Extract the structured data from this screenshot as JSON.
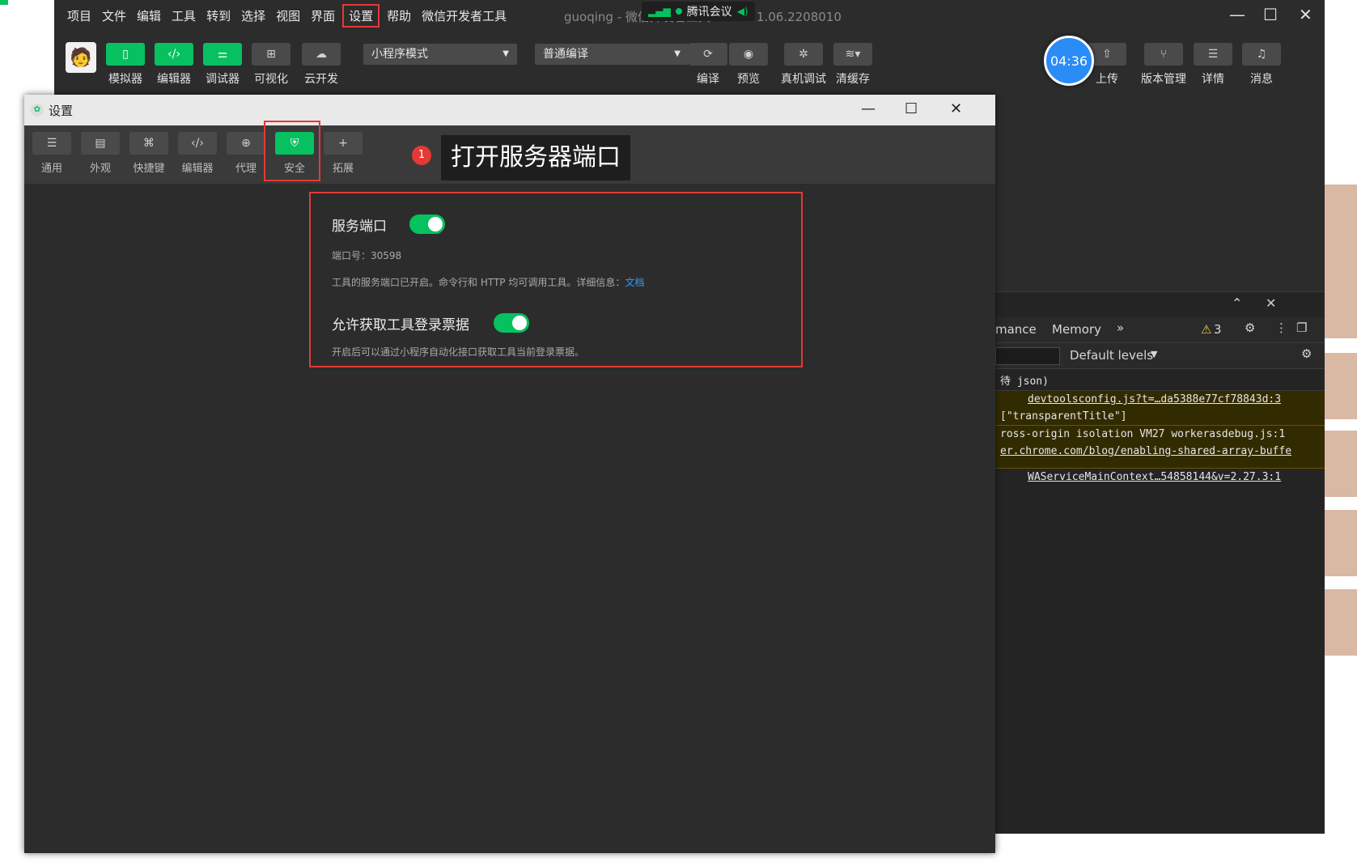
{
  "menu": {
    "items": [
      "项目",
      "文件",
      "编辑",
      "工具",
      "转到",
      "选择",
      "视图",
      "界面",
      "设置",
      "帮助",
      "微信开发者工具"
    ],
    "app_title": "guoqing - 微信开发者工具 Stable 1.06.2208010",
    "meeting_label": "腾讯会议"
  },
  "toolbar": {
    "simulator": "模拟器",
    "editor": "编辑器",
    "debugger": "调试器",
    "visual": "可视化",
    "cloud": "云开发",
    "mode_select": "小程序模式",
    "compile_select": "普通编译",
    "compile": "编译",
    "preview": "预览",
    "real_debug": "真机调试",
    "clear_cache": "清缓存",
    "upload": "上传",
    "version_mgmt": "版本管理",
    "details": "详情",
    "messages": "消息",
    "timer": "04:36"
  },
  "devtools": {
    "tab_performance": "mance",
    "tab_memory": "Memory",
    "more": "»",
    "warn_count": "3",
    "default_levels": "Default levels",
    "lines": [
      "待 json)",
      "devtoolsconfig.js?t=…da5388e77cf78843d:3",
      "[\"transparentTitle\"]",
      "ross-origin isolation VM27 workerasdebug.js:1",
      "er.chrome.com/blog/enabling-shared-array-buffe",
      "WAServiceMainContext…54858144&v=2.27.3:1"
    ]
  },
  "dialog": {
    "title": "设置",
    "tabs": [
      "通用",
      "外观",
      "快捷键",
      "编辑器",
      "代理",
      "安全",
      "拓展"
    ],
    "callout_badge": "1",
    "callout_text": "打开服务器端口",
    "service_port_title": "服务端口",
    "port_line": "端口号：30598",
    "port_desc": "工具的服务端口已开启。命令行和 HTTP 均可调用工具。详细信息：",
    "doc_link": "文档",
    "allow_ticket_title": "允许获取工具登录票据",
    "allow_ticket_desc": "开启后可以通过小程序自动化接口获取工具当前登录票据。"
  },
  "colors": {
    "accent_green": "#07c160",
    "highlight_red": "#e53935",
    "link_blue": "#2f9bff"
  }
}
